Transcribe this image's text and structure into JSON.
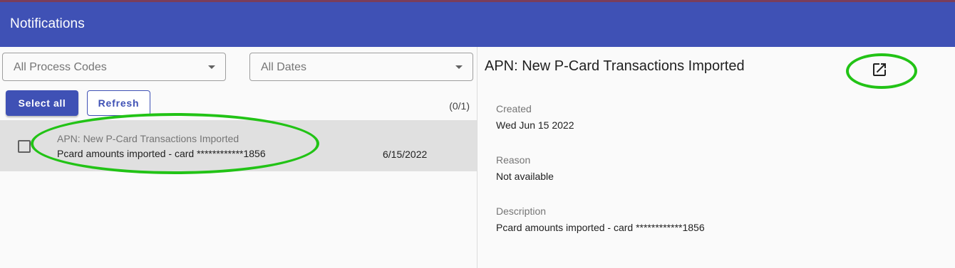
{
  "header": {
    "title": "Notifications"
  },
  "filters": {
    "process_codes": "All Process Codes",
    "dates": "All Dates"
  },
  "actions": {
    "select_all": "Select all",
    "refresh": "Refresh",
    "count": "(0/1)"
  },
  "list": [
    {
      "title": "APN: New P-Card Transactions Imported",
      "subtitle": "Pcard amounts imported - card ************1856",
      "date": "6/15/2022"
    }
  ],
  "detail": {
    "title": "APN: New P-Card Transactions Imported",
    "open_icon": "open-in-new-icon",
    "fields": [
      {
        "label": "Created",
        "value": "Wed Jun 15 2022"
      },
      {
        "label": "Reason",
        "value": "Not available"
      },
      {
        "label": "Description",
        "value": "Pcard amounts imported - card ************1856"
      }
    ]
  },
  "colors": {
    "primary": "#3f51b5",
    "highlight_annotation": "#22c316",
    "selected_row": "#e0e0e0"
  }
}
